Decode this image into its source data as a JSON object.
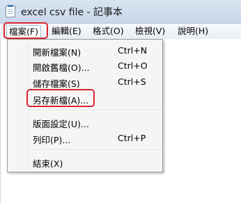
{
  "window": {
    "title": "excel csv file - 記事本"
  },
  "menubar": {
    "items": [
      {
        "label": "檔案(F)"
      },
      {
        "label": "編輯(E)"
      },
      {
        "label": "格式(O)"
      },
      {
        "label": "檢視(V)"
      },
      {
        "label": "說明(H)"
      }
    ]
  },
  "file_menu": {
    "items": [
      {
        "label": "開新檔案(N)",
        "shortcut": "Ctrl+N"
      },
      {
        "label": "開啟舊檔(O)...",
        "shortcut": "Ctrl+O"
      },
      {
        "label": "儲存檔案(S)",
        "shortcut": "Ctrl+S"
      },
      {
        "label": "另存新檔(A)...",
        "shortcut": ""
      },
      {
        "label": "版面設定(U)...",
        "shortcut": ""
      },
      {
        "label": "列印(P)...",
        "shortcut": "Ctrl+P"
      },
      {
        "label": "結束(X)",
        "shortcut": ""
      }
    ]
  },
  "colors": {
    "highlight": "#d9232e",
    "menu_background": "#f5f5f5",
    "title_bar": "#d9e4f1"
  }
}
